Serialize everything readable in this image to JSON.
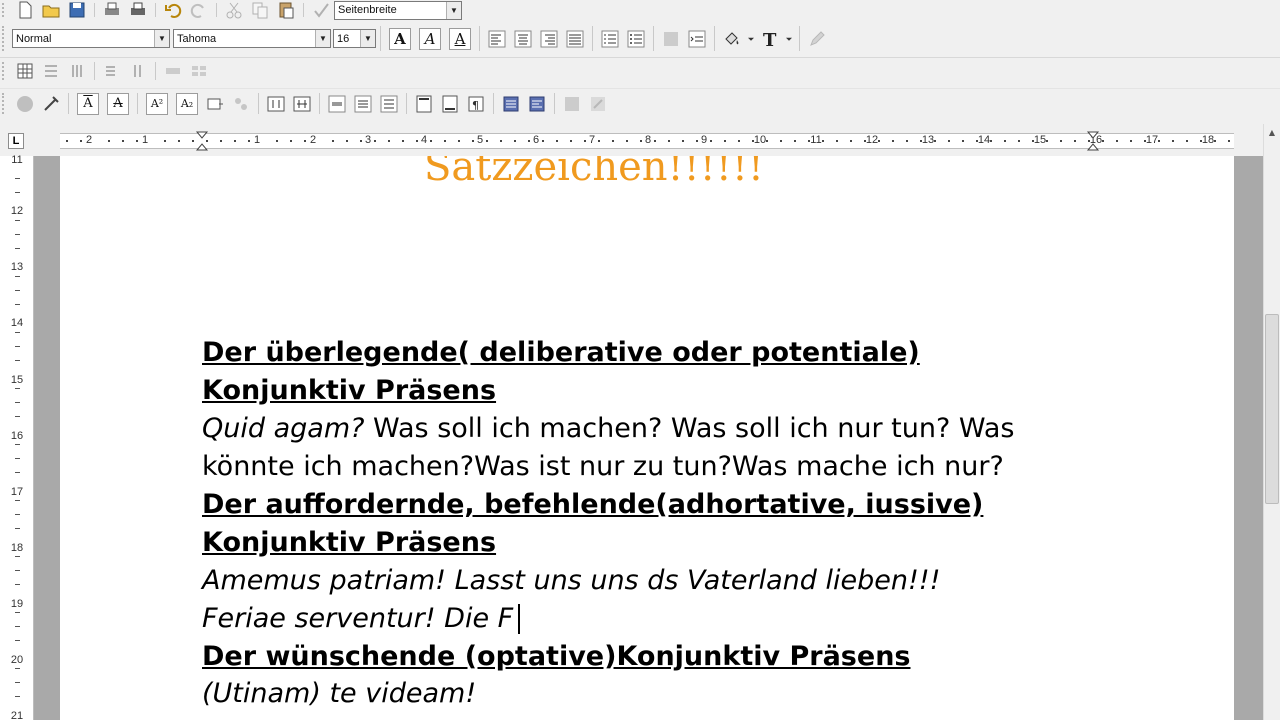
{
  "toolbar": {
    "zoom_value": "Seitenbreite",
    "style_value": "Normal",
    "font_value": "Tahoma",
    "size_value": "16",
    "icons": [
      "new-document-icon",
      "open-folder-icon",
      "save-icon",
      "print-preview-icon",
      "print-icon",
      "undo-icon",
      "redo-icon",
      "cut-icon",
      "copy-icon",
      "paste-icon",
      "spellcheck-icon",
      "bold-icon",
      "italic-icon",
      "outline-icon",
      "align-left-icon",
      "align-center-icon",
      "align-right-icon",
      "justify-icon",
      "numbered-list-icon",
      "bullet-list-icon",
      "text-color-icon",
      "font-color-icon",
      "pen-icon"
    ]
  },
  "ruler": {
    "tab_selector": "L",
    "h_numbers": [
      "2",
      "1",
      "1",
      "2",
      "3",
      "4",
      "5",
      "6",
      "7",
      "8",
      "9",
      "10",
      "11",
      "12",
      "13",
      "14",
      "15",
      "16",
      "17",
      "18"
    ],
    "v_numbers": [
      "11",
      "12",
      "13",
      "14",
      "15",
      "16",
      "17",
      "18",
      "19",
      "20",
      "21"
    ]
  },
  "document": {
    "heading": "Satzzeichen!!!!!!",
    "lines": [
      {
        "text": "Der überlegende( deliberative oder potentiale) ",
        "style": "bold"
      },
      {
        "text": "Konjunktiv Präsens",
        "style": "bold"
      },
      {
        "italic": "Quid agam?",
        "text": " Was soll ich machen? Was soll ich nur tun? Was",
        "style": "mixed"
      },
      {
        "text": "könnte ich machen?Was ist nur zu tun?Was mache ich nur?",
        "style": "plain"
      },
      {
        "text": "Der auffordernde, befehlende(adhortative, iussive) ",
        "style": "bold"
      },
      {
        "text": "Konjunktiv Präsens ",
        "style": "bold"
      },
      {
        "text": "Amemus patriam! Lasst uns uns ds Vaterland lieben!!!",
        "style": "italic"
      },
      {
        "text": "Feriae serventur! Die F",
        "style": "italic"
      },
      {
        "text": "Der wünschende (optative)Konjunktiv Präsens ",
        "style": "bold"
      },
      {
        "text": "(Utinam) te videam!",
        "style": "italic"
      }
    ]
  },
  "colors": {
    "heading": "#f09a1f",
    "page": "#ffffff",
    "workspace": "#a9a9a9",
    "toolbar": "#f0f0f0"
  }
}
